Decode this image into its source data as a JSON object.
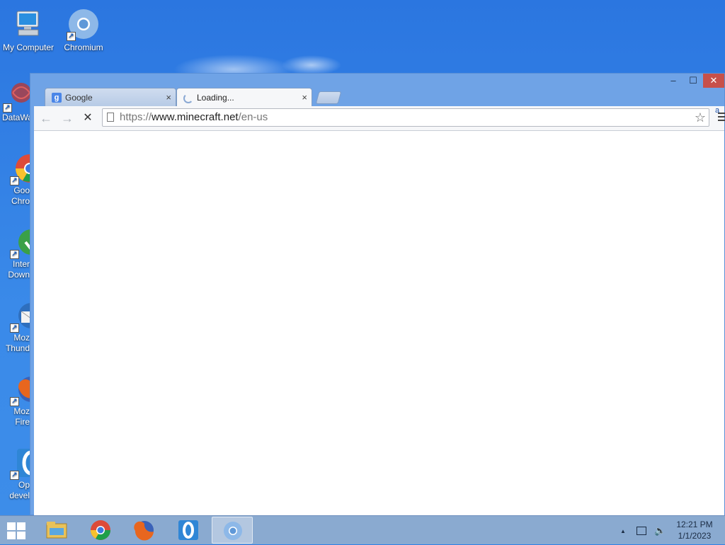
{
  "desktop": {
    "icons": [
      {
        "label": "My Computer"
      },
      {
        "label": "Chromium"
      }
    ],
    "left_icons": [
      {
        "label": "DataWa"
      },
      {
        "label": "Goo\nChro"
      },
      {
        "label": "Inter\nDown"
      },
      {
        "label": "Moz\nThund"
      },
      {
        "label": "Moz\nFire"
      },
      {
        "label": "Op\ndevel"
      }
    ]
  },
  "window": {
    "controls": {
      "minimize": "–",
      "maximize": "☐",
      "close": "✕"
    },
    "tabs": [
      {
        "title": "Google",
        "close": "×",
        "favicon_letter": "g"
      },
      {
        "title": "Loading...",
        "close": "×"
      }
    ]
  },
  "toolbar": {
    "back": "←",
    "forward": "→",
    "stop": "✕",
    "url_scheme": "https://",
    "url_host": "www.minecraft.net",
    "url_path": "/en-us",
    "star": "☆",
    "ext_badge": "a"
  },
  "taskbar": {
    "items": [
      "file-explorer-icon",
      "chrome-icon",
      "firefox-icon",
      "opera-icon",
      "chromium-icon"
    ],
    "tray": {
      "up_arrow": "▲"
    },
    "clock": {
      "time": "12:21 PM",
      "date": "1/1/2023"
    }
  },
  "colors": {
    "close_red": "#c7504a",
    "desktop_blue": "#2f7fe6",
    "taskbar": "#8aaad0"
  }
}
